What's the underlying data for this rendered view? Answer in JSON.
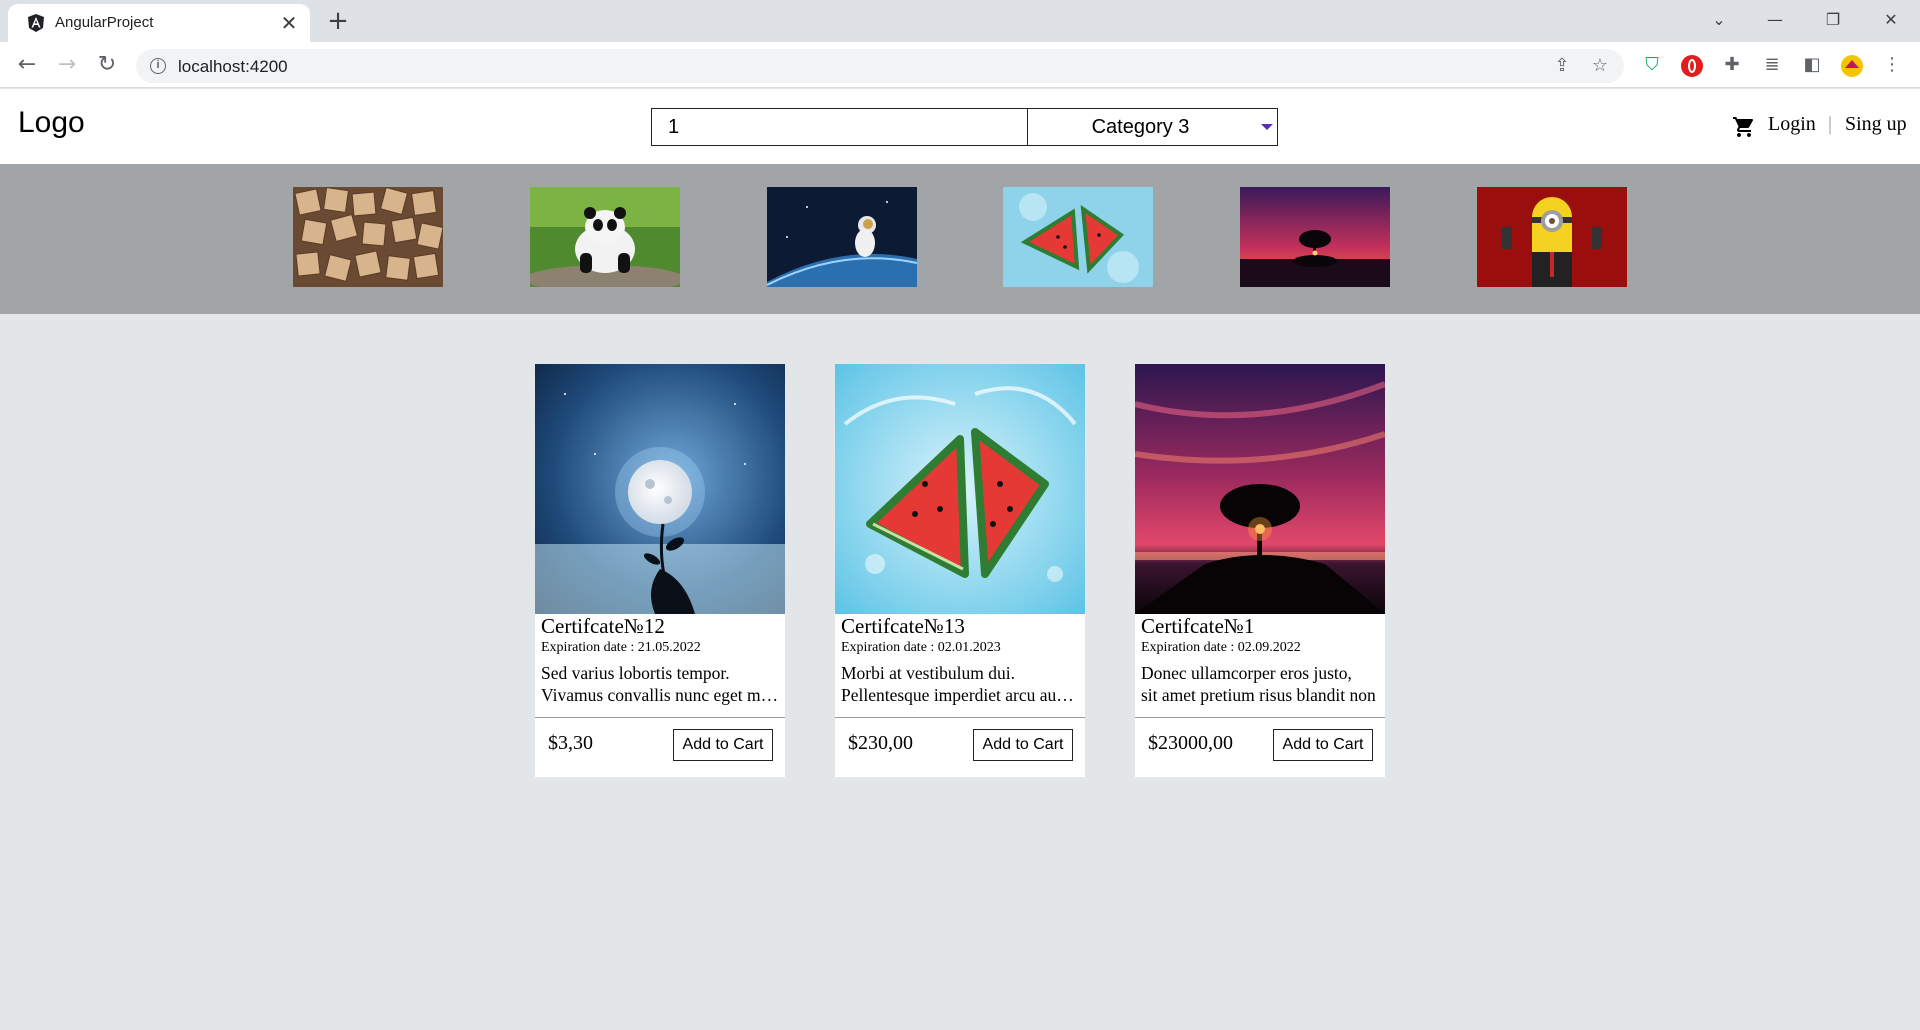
{
  "browser": {
    "tab_title": "AngularProject",
    "tab_close": "✕",
    "new_tab": "+",
    "url": "localhost:4200",
    "window_controls": {
      "dropdown": "⌄",
      "minimize": "—",
      "restore": "❐",
      "close": "✕"
    }
  },
  "header": {
    "logo": "Logo",
    "search_value": "1",
    "category_selected": "Category 3",
    "login": "Login",
    "separator": "|",
    "signup": "Sing up"
  },
  "categories": [
    {
      "icon": "scrabble-tiles-image"
    },
    {
      "icon": "panda-image"
    },
    {
      "icon": "astronaut-image"
    },
    {
      "icon": "watermelon-image"
    },
    {
      "icon": "sunset-tree-image"
    },
    {
      "icon": "minion-image"
    }
  ],
  "products": [
    {
      "title": "Certifcate№12",
      "expiration": "Expiration date : 21.05.2022",
      "desc_line1": "Sed varius lobortis tempor.",
      "desc_line2": "Vivamus convallis nunc eget massa",
      "price": "$3,30",
      "button": "Add to Cart",
      "image": "moon-hand-image"
    },
    {
      "title": "Certifcate№13",
      "expiration": "Expiration date : 02.01.2023",
      "desc_line1": "Morbi at vestibulum dui.",
      "desc_line2": "Pellentesque imperdiet arcu auctor",
      "price": "$230,00",
      "button": "Add to Cart",
      "image": "watermelon-image"
    },
    {
      "title": "Certifcate№1",
      "expiration": "Expiration date : 02.09.2022",
      "desc_line1": "Donec ullamcorper eros justo,",
      "desc_line2": "sit amet pretium risus blandit non",
      "price": "$23000,00",
      "button": "Add to Cart",
      "image": "sunset-tree-image"
    }
  ],
  "colors": {
    "page_bg": "#e3e6e9",
    "strip_bg": "#a1a5a7",
    "select_arrow": "#5a2fb5"
  }
}
